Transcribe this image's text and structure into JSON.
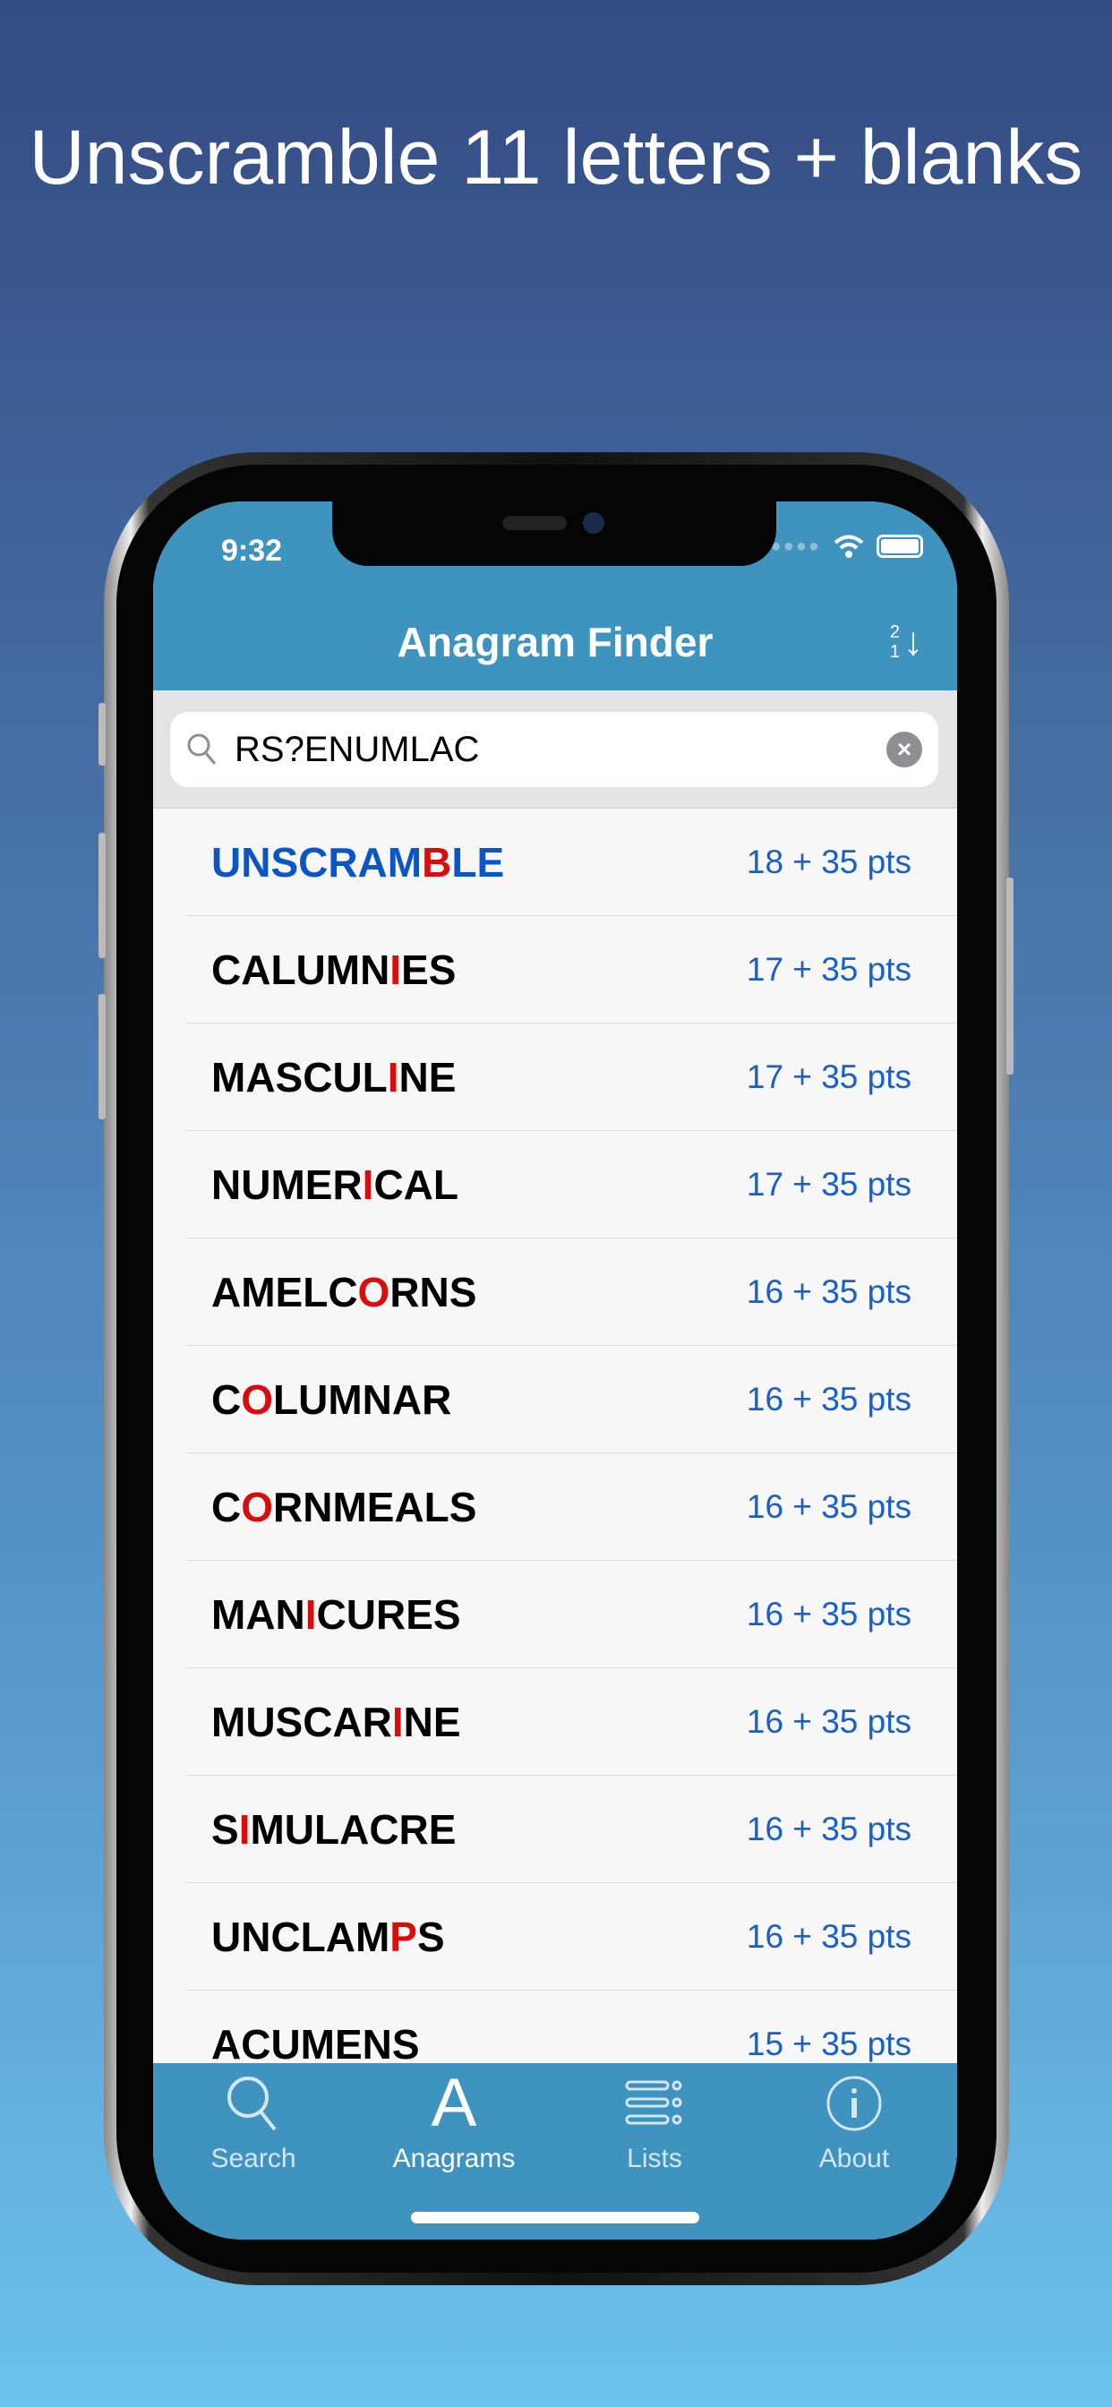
{
  "headline": "Unscramble 11 letters + blanks",
  "status_bar": {
    "time": "9:32"
  },
  "navbar": {
    "title": "Anagram Finder",
    "sort_icon": "sort-descending-21-icon",
    "sort_top": "2",
    "sort_bottom": "1"
  },
  "search": {
    "value": "RS?ENUMLAC",
    "placeholder": ""
  },
  "results": [
    {
      "pre": "UNSCRAM",
      "hl": "B",
      "post": "LE",
      "pts": "18 + 35 pts",
      "highlighted": true
    },
    {
      "pre": "CALUMN",
      "hl": "I",
      "post": "ES",
      "pts": "17 + 35 pts"
    },
    {
      "pre": "MASCUL",
      "hl": "I",
      "post": "NE",
      "pts": "17 + 35 pts"
    },
    {
      "pre": "NUMER",
      "hl": "I",
      "post": "CAL",
      "pts": "17 + 35 pts"
    },
    {
      "pre": "AMELC",
      "hl": "O",
      "post": "RNS",
      "pts": "16 + 35 pts"
    },
    {
      "pre": "C",
      "hl": "O",
      "post": "LUMNAR",
      "pts": "16 + 35 pts"
    },
    {
      "pre": "C",
      "hl": "O",
      "post": "RNMEALS",
      "pts": "16 + 35 pts"
    },
    {
      "pre": "MAN",
      "hl": "I",
      "post": "CURES",
      "pts": "16 + 35 pts"
    },
    {
      "pre": "MUSCAR",
      "hl": "I",
      "post": "NE",
      "pts": "16 + 35 pts"
    },
    {
      "pre": "S",
      "hl": "I",
      "post": "MULACRE",
      "pts": "16 + 35 pts"
    },
    {
      "pre": "UNCLAM",
      "hl": "P",
      "post": "S",
      "pts": "16 + 35 pts"
    },
    {
      "pre": "ACUMENS",
      "hl": "",
      "post": "",
      "pts": "15 + 35 pts"
    }
  ],
  "tabs": [
    {
      "label": "Search",
      "icon": "magnifier-icon"
    },
    {
      "label": "Anagrams",
      "icon": "letter-a-icon",
      "glyph": "A",
      "active": true
    },
    {
      "label": "Lists",
      "icon": "list-icon"
    },
    {
      "label": "About",
      "icon": "info-icon"
    }
  ],
  "colors": {
    "accent": "#3e93bf",
    "highlight": "#d80d0d",
    "points": "#1a5ec8",
    "first_word": "#0b55c4"
  }
}
